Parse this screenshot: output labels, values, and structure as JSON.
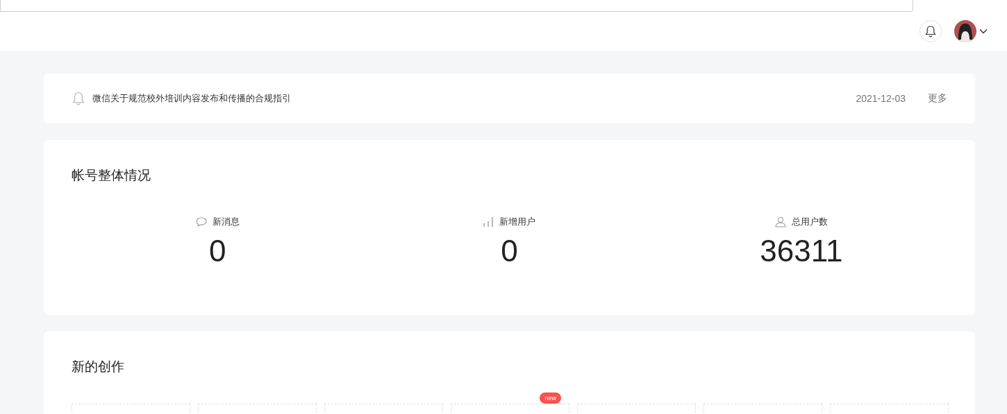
{
  "notice": {
    "title": "微信关于规范校外培训内容发布和传播的合规指引",
    "date": "2021-12-03",
    "more": "更多"
  },
  "overview": {
    "title": "帐号整体情况",
    "stats": [
      {
        "kind": "message",
        "label": "新消息",
        "value": "0"
      },
      {
        "kind": "chart",
        "label": "新增用户",
        "value": "0"
      },
      {
        "kind": "user",
        "label": "总用户数",
        "value": "36311"
      }
    ]
  },
  "creation": {
    "title": "新的创作",
    "tiles": [
      {
        "kind": "plain"
      },
      {
        "kind": "plain"
      },
      {
        "kind": "plain"
      },
      {
        "kind": "badged",
        "badge": "new"
      },
      {
        "kind": "plain"
      },
      {
        "kind": "plain"
      },
      {
        "kind": "plain"
      }
    ]
  }
}
